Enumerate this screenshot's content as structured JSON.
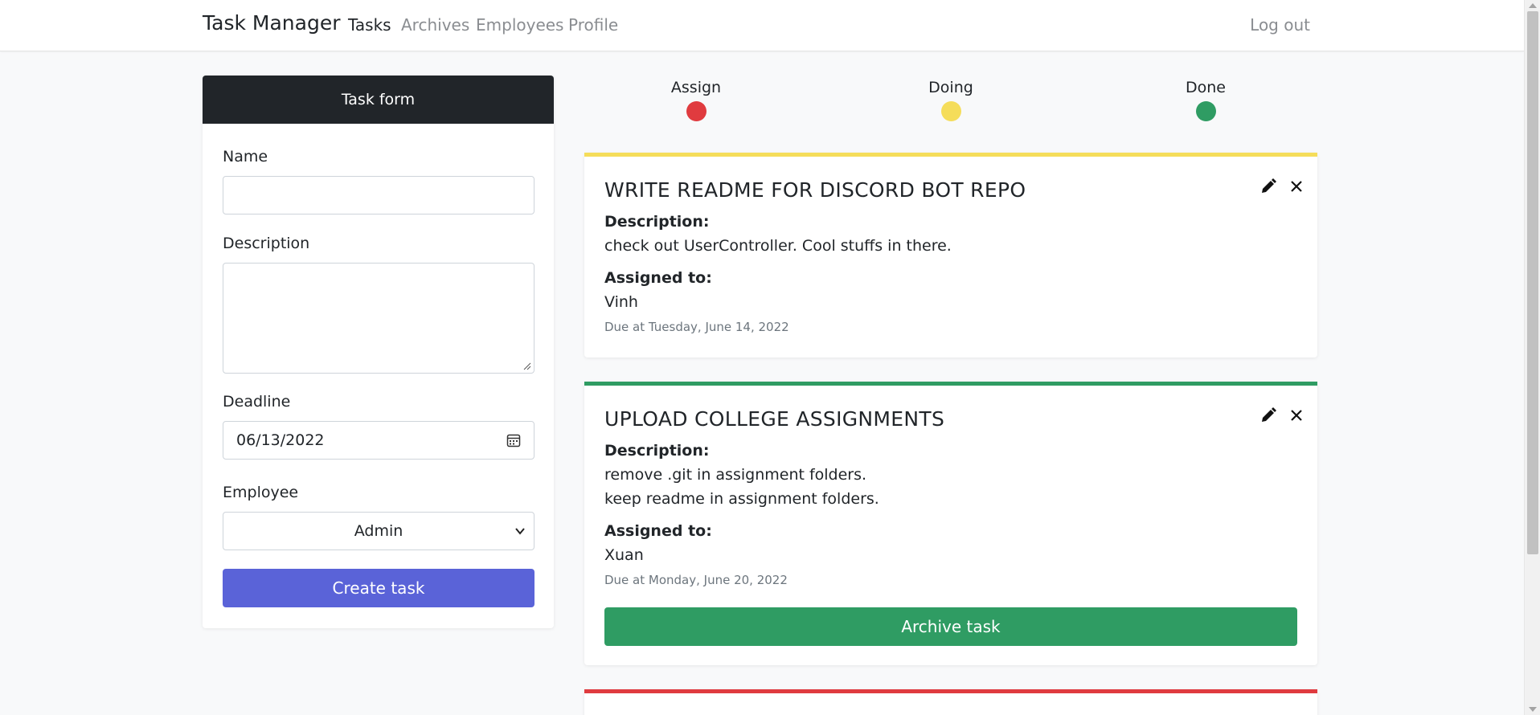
{
  "navbar": {
    "brand": "Task Manager",
    "links": [
      {
        "label": "Tasks",
        "active": true
      },
      {
        "label": "Archives",
        "active": false
      },
      {
        "label": "Employees",
        "active": false
      },
      {
        "label": "Profile",
        "active": false
      }
    ],
    "logout_label": "Log out"
  },
  "form": {
    "header": "Task form",
    "name_label": "Name",
    "name_value": "",
    "description_label": "Description",
    "description_value": "",
    "deadline_label": "Deadline",
    "deadline_value": "06/13/2022",
    "employee_label": "Employee",
    "employee_selected": "Admin",
    "submit_label": "Create task"
  },
  "legend": [
    {
      "label": "Assign",
      "color": "#e03b3f"
    },
    {
      "label": "Doing",
      "color": "#f5dd5a"
    },
    {
      "label": "Done",
      "color": "#2f9c63"
    }
  ],
  "labels": {
    "description": "Description:",
    "assigned": "Assigned to:"
  },
  "tasks": [
    {
      "title": "WRITE README FOR DISCORD BOT REPO",
      "status_color": "#f5dd5a",
      "description_lines": [
        "check out UserController. Cool stuffs in there."
      ],
      "assignee": "Vinh",
      "due": "Due at Tuesday, June 14, 2022"
    },
    {
      "title": "UPLOAD COLLEGE ASSIGNMENTS",
      "status_color": "#2f9c63",
      "description_lines": [
        "remove .git in assignment folders.",
        "keep readme in assignment folders."
      ],
      "assignee": "Xuan",
      "due": "Due at Monday, June 20, 2022",
      "archive_label": "Archive task"
    },
    {
      "status_color": "#e03b3f"
    }
  ],
  "icons": {
    "edit": "pencil-icon",
    "delete": "close-icon",
    "calendar": "calendar-icon",
    "select": "chevron-down-icon"
  }
}
